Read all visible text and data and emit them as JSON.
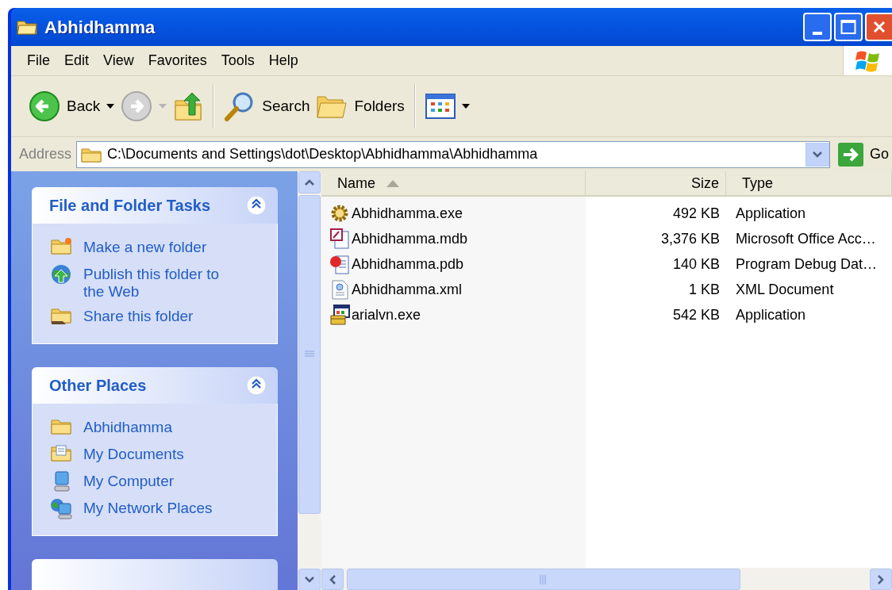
{
  "window": {
    "title": "Abhidhamma"
  },
  "menu": [
    "File",
    "Edit",
    "View",
    "Favorites",
    "Tools",
    "Help"
  ],
  "toolbar": [
    {
      "kind": "back",
      "label": "Back",
      "disabled": false
    },
    {
      "kind": "forward",
      "disabled": true
    },
    {
      "kind": "up",
      "disabled": false
    },
    {
      "kind": "search",
      "label": "Search",
      "disabled": false
    },
    {
      "kind": "folders",
      "label": "Folders",
      "disabled": false
    },
    {
      "kind": "views",
      "disabled": false
    }
  ],
  "address": {
    "label": "Address",
    "value": "C:\\Documents and Settings\\dot\\Desktop\\Abhidhamma\\Abhidhamma",
    "go": "Go"
  },
  "task_panels": [
    {
      "title": "File and Folder Tasks",
      "expanded": true,
      "items": [
        {
          "kind": "new-folder",
          "label": "Make a new folder"
        },
        {
          "kind": "publish",
          "label": "Publish this folder to the Web"
        },
        {
          "kind": "share",
          "label": "Share this folder"
        }
      ]
    },
    {
      "title": "Other Places",
      "expanded": true,
      "items": [
        {
          "kind": "folder",
          "label": "Abhidhamma"
        },
        {
          "kind": "documents",
          "label": "My Documents"
        },
        {
          "kind": "computer",
          "label": "My Computer"
        },
        {
          "kind": "network",
          "label": "My Network Places"
        }
      ]
    }
  ],
  "file_list": {
    "columns": [
      {
        "label": "Name",
        "sorted": true
      },
      {
        "label": "Size",
        "sorted": false
      },
      {
        "label": "Type",
        "sorted": false
      }
    ],
    "rows": [
      {
        "kind": "gear-app",
        "name": "Abhidhamma.exe",
        "size": "492 KB",
        "type": "Application"
      },
      {
        "kind": "database",
        "name": "Abhidhamma.mdb",
        "size": "3,376 KB",
        "type": "Microsoft Office Acc…"
      },
      {
        "kind": "debug",
        "name": "Abhidhamma.pdb",
        "size": "140 KB",
        "type": "Program Debug Dat…"
      },
      {
        "kind": "xml",
        "name": "Abhidhamma.xml",
        "size": "1 KB",
        "type": "XML Document"
      },
      {
        "kind": "installer",
        "name": "arialvn.exe",
        "size": "542 KB",
        "type": "Application"
      }
    ]
  }
}
